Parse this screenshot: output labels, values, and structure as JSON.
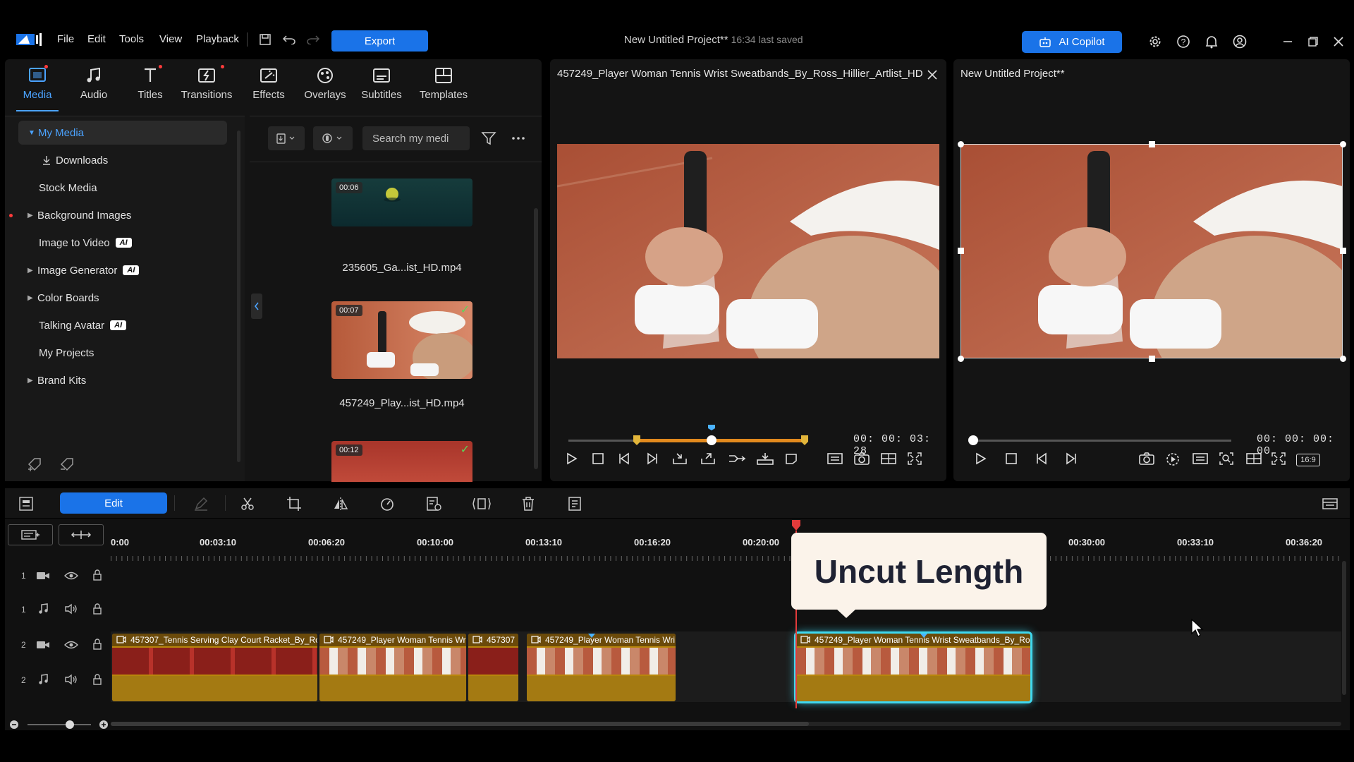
{
  "menu": {
    "file": "File",
    "edit": "Edit",
    "tools": "Tools",
    "view": "View",
    "playback": "Playback",
    "export": "Export"
  },
  "header": {
    "project_title": "New Untitled Project**",
    "saved_status": "16:34 last saved",
    "ai_copilot": "AI Copilot"
  },
  "tabs": [
    "Media",
    "Audio",
    "Titles",
    "Transitions",
    "Effects",
    "Overlays",
    "Subtitles",
    "Templates"
  ],
  "library": {
    "items": [
      {
        "label": "My Media",
        "ai": false
      },
      {
        "label": "Downloads",
        "ai": false
      },
      {
        "label": "Stock Media",
        "ai": false
      },
      {
        "label": "Background Images",
        "ai": false
      },
      {
        "label": "Image to Video",
        "ai": true
      },
      {
        "label": "Image Generator",
        "ai": true
      },
      {
        "label": "Color Boards",
        "ai": false
      },
      {
        "label": "Talking Avatar",
        "ai": true
      },
      {
        "label": "My Projects",
        "ai": false
      },
      {
        "label": "Brand Kits",
        "ai": false
      }
    ],
    "ai_badge": "AI"
  },
  "media": {
    "search_placeholder": "Search my medi",
    "files": [
      {
        "duration": "00:06",
        "name": "235605_Ga...ist_HD.mp4"
      },
      {
        "duration": "00:07",
        "name": "457249_Play...ist_HD.mp4"
      },
      {
        "duration": "00:12",
        "name": ""
      }
    ]
  },
  "source_preview": {
    "title": "457249_Player Woman Tennis Wrist Sweatbands_By_Ross_Hillier_Artlist_HD....",
    "timecode": "00: 00: 03: 28"
  },
  "project_preview": {
    "title": "New Untitled Project**",
    "timecode": "00: 00: 00: 00",
    "aspect": "16:9"
  },
  "toolbar": {
    "edit_tab": "Edit"
  },
  "timeline": {
    "ruler": [
      "0:00",
      "00:03:10",
      "00:06:20",
      "00:10:00",
      "00:13:10",
      "00:16:20",
      "00:20:00",
      "00:30:00",
      "00:33:10",
      "00:36:20"
    ],
    "tracks": [
      "1",
      "1",
      "2",
      "2"
    ],
    "clips": [
      {
        "title": "457307_Tennis Serving Clay Court Racket_By_Ross"
      },
      {
        "title": "457249_Player Woman Tennis Wri"
      },
      {
        "title": "457307"
      },
      {
        "title": "457249_Player Woman Tennis Wri"
      },
      {
        "title": "457249_Player Woman Tennis Wrist Sweatbands_By_Ross"
      }
    ],
    "tooltip": "Uncut Length"
  }
}
